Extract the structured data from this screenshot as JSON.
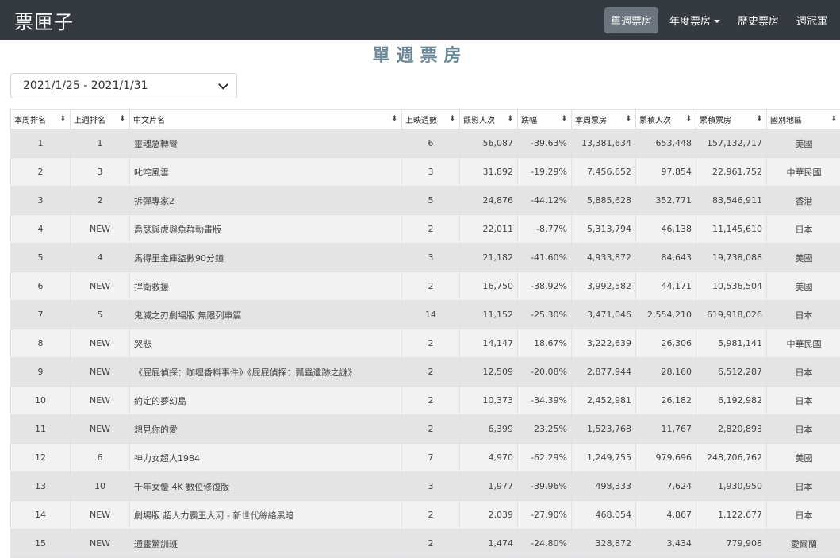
{
  "brand": "票匣子",
  "nav": [
    {
      "label": "單週票房",
      "active": true
    },
    {
      "label": "年度票房",
      "dropdown": true
    },
    {
      "label": "歷史票房"
    },
    {
      "label": "週冠軍"
    }
  ],
  "page_title": "單週票房",
  "week_select": {
    "value": "2021/1/25 - 2021/1/31"
  },
  "table": {
    "headers": [
      "本周排名",
      "上週排名",
      "中文片名",
      "上映週數",
      "觀影人次",
      "跌幅",
      "本周票房",
      "累積人次",
      "累積票房",
      "國別地區"
    ],
    "rows": [
      [
        "1",
        "1",
        "靈魂急轉彎",
        "6",
        "56,087",
        "-39.63%",
        "13,381,634",
        "653,448",
        "157,132,717",
        "美國"
      ],
      [
        "2",
        "3",
        "叱咤風雲",
        "3",
        "31,892",
        "-19.29%",
        "7,456,652",
        "97,854",
        "22,961,752",
        "中華民國"
      ],
      [
        "3",
        "2",
        "拆彈專家2",
        "5",
        "24,876",
        "-44.12%",
        "5,885,628",
        "352,771",
        "83,546,911",
        "香港"
      ],
      [
        "4",
        "NEW",
        "喬瑟與虎與魚群動畫版",
        "2",
        "22,011",
        "-8.77%",
        "5,313,794",
        "46,138",
        "11,145,610",
        "日本"
      ],
      [
        "5",
        "4",
        "馬得里金庫盜數90分鐘",
        "3",
        "21,182",
        "-41.60%",
        "4,933,872",
        "84,643",
        "19,738,088",
        "美國"
      ],
      [
        "6",
        "NEW",
        "捍衛救援",
        "2",
        "16,750",
        "-38.92%",
        "3,992,582",
        "44,171",
        "10,536,504",
        "美國"
      ],
      [
        "7",
        "5",
        "鬼滅之刃劇場版 無限列車篇",
        "14",
        "11,152",
        "-25.30%",
        "3,471,046",
        "2,554,210",
        "619,918,026",
        "日本"
      ],
      [
        "8",
        "NEW",
        "哭悲",
        "2",
        "14,147",
        "18.67%",
        "3,222,639",
        "26,306",
        "5,981,141",
        "中華民國"
      ],
      [
        "9",
        "NEW",
        "《屁屁偵探：咖哩香料事件》《屁屁偵探：瓢蟲遺跡之謎》",
        "2",
        "12,509",
        "-20.08%",
        "2,877,944",
        "28,160",
        "6,512,287",
        "日本"
      ],
      [
        "10",
        "NEW",
        "約定的夢幻島",
        "2",
        "10,373",
        "-34.39%",
        "2,452,981",
        "26,182",
        "6,192,982",
        "日本"
      ],
      [
        "11",
        "NEW",
        "想見你的愛",
        "2",
        "6,399",
        "23.25%",
        "1,523,768",
        "11,767",
        "2,820,893",
        "日本"
      ],
      [
        "12",
        "6",
        "神力女超人1984",
        "7",
        "4,970",
        "-62.29%",
        "1,249,755",
        "979,696",
        "248,706,762",
        "美國"
      ],
      [
        "13",
        "10",
        "千年女優 4K 數位修復版",
        "3",
        "1,977",
        "-39.96%",
        "498,333",
        "7,624",
        "1,930,950",
        "日本"
      ],
      [
        "14",
        "NEW",
        "劇場版 超人力霸王大河 - 新世代絲絡黑暗",
        "2",
        "2,039",
        "-27.90%",
        "468,054",
        "4,867",
        "1,122,677",
        "日本"
      ],
      [
        "15",
        "NEW",
        "通靈驚訓班",
        "2",
        "1,474",
        "-24.80%",
        "328,872",
        "3,434",
        "779,908",
        "愛爾蘭"
      ]
    ]
  }
}
